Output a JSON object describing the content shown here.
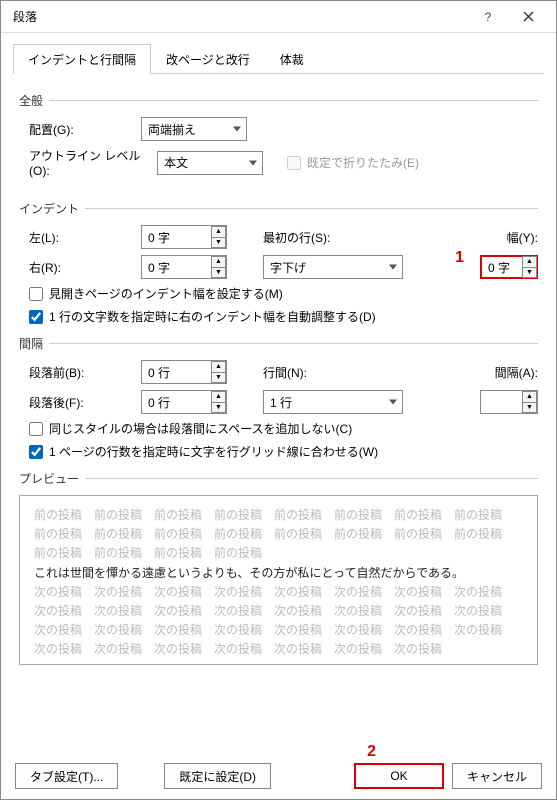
{
  "title": "段落",
  "tabs": {
    "t1": "インデントと行間隔",
    "t2": "改ページと改行",
    "t3": "体裁"
  },
  "general": {
    "hdr": "全般",
    "align_lbl": "配置(G):",
    "align_val": "両端揃え",
    "outline_lbl": "アウトライン レベル(O):",
    "outline_val": "本文",
    "fold_lbl": "既定で折りたたみ(E)"
  },
  "indent": {
    "hdr": "インデント",
    "left_lbl": "左(L):",
    "left_val": "0 字",
    "right_lbl": "右(R):",
    "right_val": "0 字",
    "first_lbl": "最初の行(S):",
    "first_val": "字下げ",
    "width_lbl": "幅(Y):",
    "width_val": "0 字",
    "mirror_lbl": "見開きページのインデント幅を設定する(M)",
    "auto_lbl": "1 行の文字数を指定時に右のインデント幅を自動調整する(D)"
  },
  "spacing": {
    "hdr": "間隔",
    "before_lbl": "段落前(B):",
    "before_val": "0 行",
    "after_lbl": "段落後(F):",
    "after_val": "0 行",
    "line_lbl": "行間(N):",
    "line_val": "1 行",
    "at_lbl": "間隔(A):",
    "at_val": "",
    "nospace_lbl": "同じスタイルの場合は段落間にスペースを追加しない(C)",
    "grid_lbl": "1 ページの行数を指定時に文字を行グリッド線に合わせる(W)"
  },
  "preview": {
    "hdr": "プレビュー",
    "grey": "前の投稿　前の投稿　前の投稿　前の投稿　前の投稿　前の投稿　前の投稿　前の投稿　前の投稿　前の投稿　前の投稿　前の投稿　前の投稿　前の投稿　前の投稿　前の投稿　前の投稿　前の投稿　前の投稿　前の投稿",
    "real": "これは世間を憚かる遠慮というよりも、その方が私にとって自然だからである。",
    "grey2": "次の投稿　次の投稿　次の投稿　次の投稿　次の投稿　次の投稿　次の投稿　次の投稿　次の投稿　次の投稿　次の投稿　次の投稿　次の投稿　次の投稿　次の投稿　次の投稿　次の投稿　次の投稿　次の投稿　次の投稿　次の投稿　次の投稿　次の投稿　次の投稿　次の投稿　次の投稿　次の投稿　次の投稿　次の投稿　次の投稿　次の投稿"
  },
  "buttons": {
    "tabs": "タブ設定(T)...",
    "default": "既定に設定(D)",
    "ok": "OK",
    "cancel": "キャンセル"
  },
  "ann": {
    "a1": "1",
    "a2": "2"
  }
}
